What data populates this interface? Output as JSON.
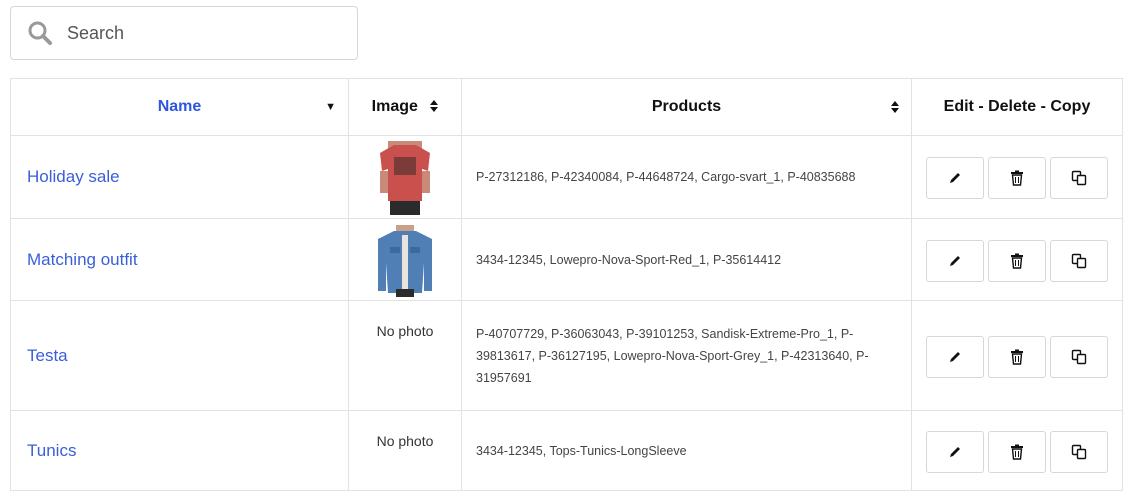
{
  "search": {
    "placeholder": "Search"
  },
  "table": {
    "headers": {
      "name": "Name",
      "image": "Image",
      "products": "Products",
      "actions": "Edit - Delete - Copy"
    },
    "rows": [
      {
        "name": "Holiday sale",
        "image": "red-tshirt-photo",
        "image_text": "",
        "products": "P-27312186, P-42340084, P-44648724, Cargo-svart_1, P-40835688"
      },
      {
        "name": "Matching outfit",
        "image": "denim-jacket-photo",
        "image_text": "",
        "products": "3434-12345, Lowepro-Nova-Sport-Red_1, P-35614412"
      },
      {
        "name": "Testa",
        "image": "none",
        "image_text": "No photo",
        "products": "P-40707729, P-36063043, P-39101253, Sandisk-Extreme-Pro_1, P-39813617, P-36127195, Lowepro-Nova-Sport-Grey_1, P-42313640, P-31957691"
      },
      {
        "name": "Tunics",
        "image": "none",
        "image_text": "No photo",
        "products": "3434-12345, Tops-Tunics-LongSleeve"
      }
    ]
  },
  "icons": {
    "search": "search-icon",
    "edit": "pencil-icon",
    "delete": "trash-icon",
    "copy": "copy-icon",
    "sort_desc": "caret-down-icon",
    "sort_both": "sort-icon"
  },
  "colors": {
    "link": "#3a5fd8",
    "header_name": "#2f56e0",
    "border": "#e2e2e2"
  }
}
